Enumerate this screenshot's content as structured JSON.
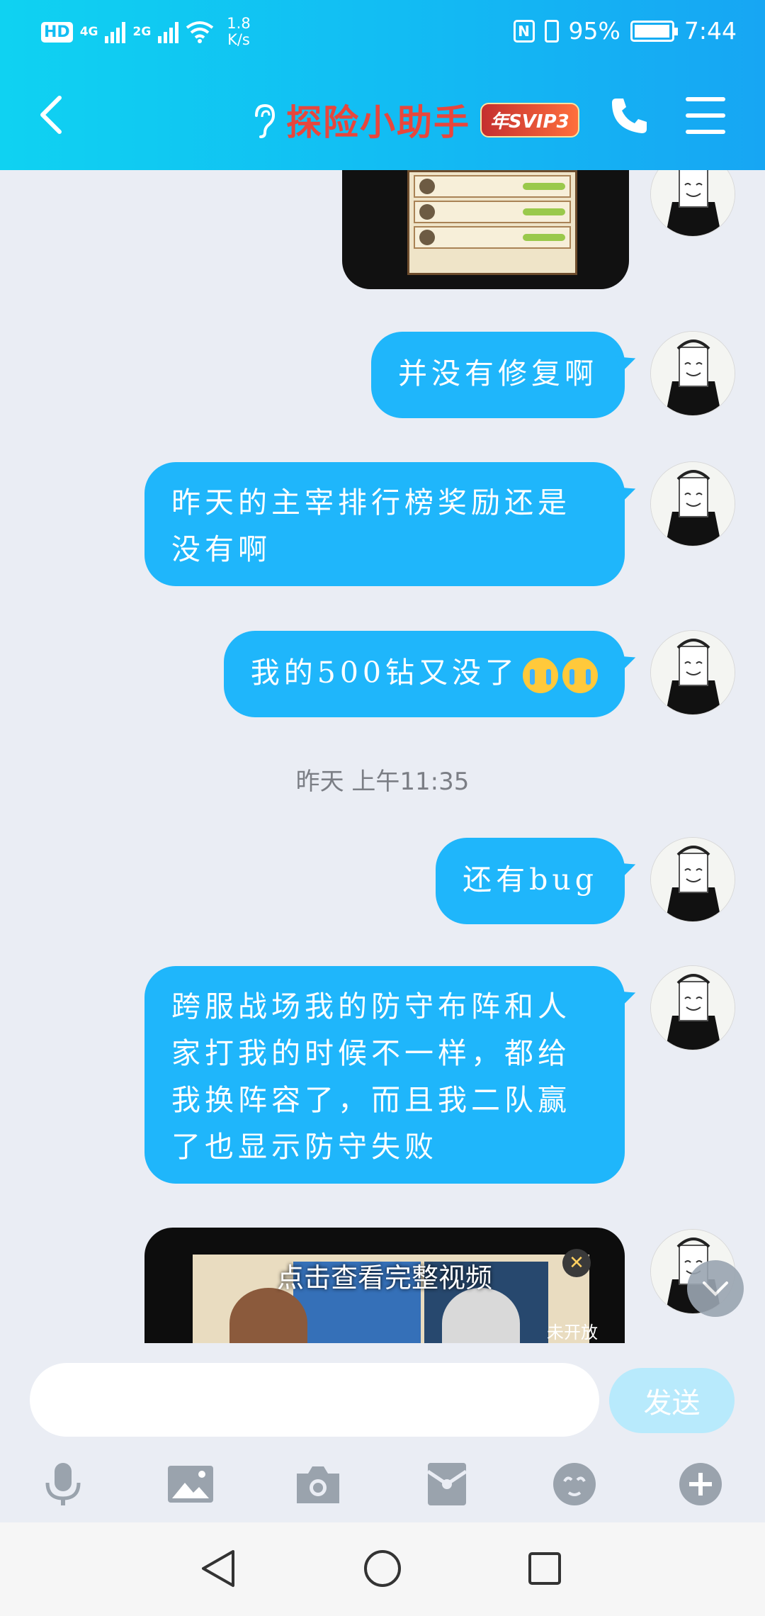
{
  "status_bar": {
    "hd": "HD",
    "net1": "4G",
    "net2": "2G",
    "speed_value": "1.8",
    "speed_unit": "K/s",
    "nfc": "N",
    "battery": "95%",
    "time": "7:44"
  },
  "header": {
    "title": "探险小助手",
    "badge": "年SVIP3",
    "title_color": "#e8463c",
    "bg_color": "#12bdf3"
  },
  "messages": [
    {
      "type": "image",
      "desc_icon": "leaderboard-screenshot"
    },
    {
      "type": "text",
      "text": "并没有修复啊"
    },
    {
      "type": "text",
      "lines": [
        "昨天的主宰排行榜奖励还是",
        "没有啊"
      ]
    },
    {
      "type": "text",
      "text": "我的500钻又没了"
    },
    {
      "type": "timestamp",
      "text": "昨天 上午11:35"
    },
    {
      "type": "text",
      "text": "还有bug"
    },
    {
      "type": "text",
      "lines": [
        "跨服战场我的防守布阵和人",
        "家打我的时候不一样，都给",
        "我换阵容了，而且我二队赢",
        "了也显示防守失败"
      ]
    },
    {
      "type": "video",
      "label": "点击查看完整视频",
      "side_label": "未开放"
    }
  ],
  "input": {
    "placeholder": "",
    "send_label": "发送"
  },
  "toolbar": [
    "mic-icon",
    "image-icon",
    "camera-icon",
    "red-packet-icon",
    "emoji-icon",
    "plus-icon"
  ],
  "accent": "#1fb6fb"
}
